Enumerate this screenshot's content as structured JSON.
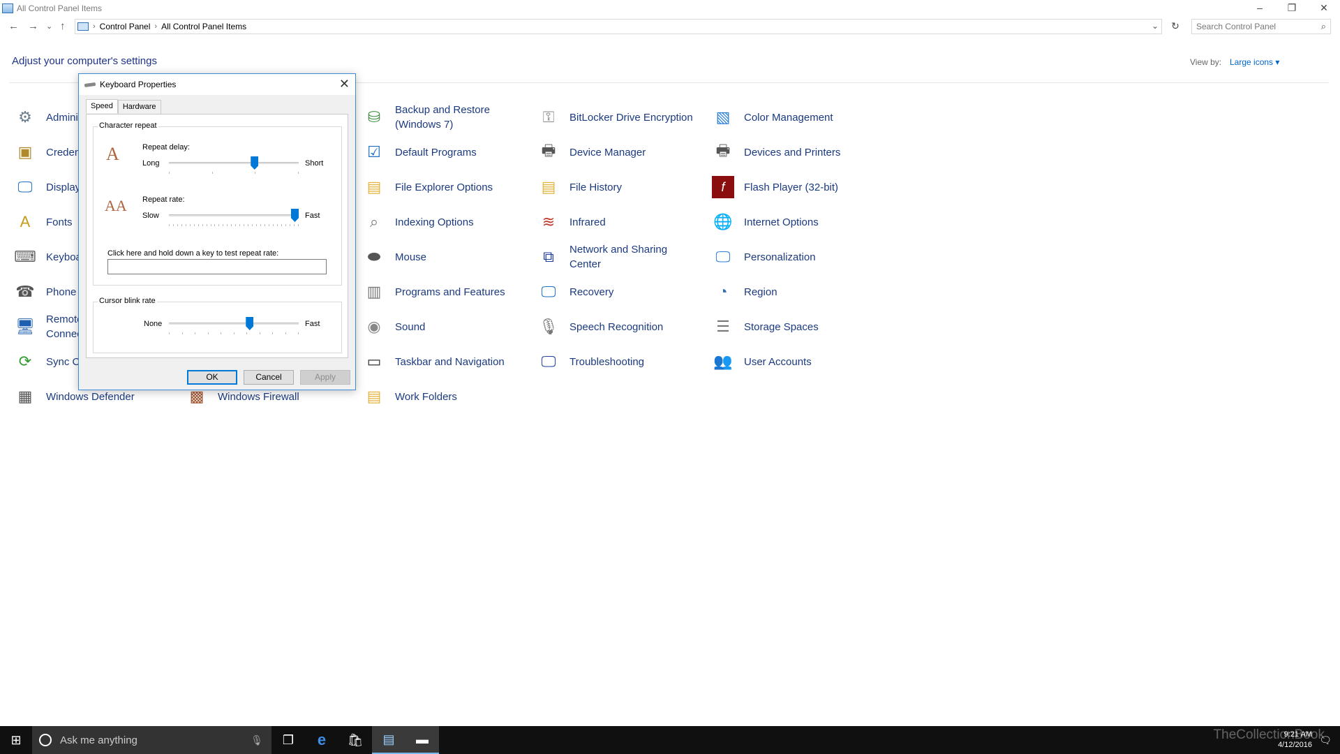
{
  "window": {
    "title": "All Control Panel Items",
    "min": "–",
    "max": "❐",
    "close": "✕"
  },
  "nav": {
    "back": "←",
    "forward": "→",
    "recent": "⌄",
    "up": "↑"
  },
  "address": {
    "crumbs": [
      "Control Panel",
      "All Control Panel Items"
    ],
    "sep": "›",
    "dropdown": "⌄",
    "refresh": "↻"
  },
  "search": {
    "placeholder": "Search Control Panel",
    "icon": "⌕"
  },
  "header": {
    "title": "Adjust your computer's settings",
    "view_by_label": "View by:",
    "view_by_value": "Large icons ▾"
  },
  "items": [
    {
      "label": "Admini",
      "icon": "admin-tools-icon"
    },
    {
      "label": "Creden",
      "icon": "credential-manager-icon"
    },
    {
      "label": "Display",
      "icon": "display-icon"
    },
    {
      "label": "Fonts",
      "icon": "fonts-icon"
    },
    {
      "label": "Keyboa",
      "icon": "keyboard-icon"
    },
    {
      "label": "Phone",
      "icon": "phone-modem-icon"
    },
    {
      "label": "Remote Connec",
      "icon": "remoteapp-icon"
    },
    {
      "label": "Sync C",
      "icon": "sync-center-icon"
    },
    {
      "label": "Windows Defender",
      "icon": "windows-defender-icon"
    },
    {
      "label": "Windows Firewall",
      "icon": "windows-firewall-icon"
    },
    {
      "label": "Backup and Restore (Windows 7)",
      "icon": "backup-icon"
    },
    {
      "label": "Default Programs",
      "icon": "default-programs-icon"
    },
    {
      "label": "File Explorer Options",
      "icon": "folder-options-icon"
    },
    {
      "label": "Indexing Options",
      "icon": "indexing-icon"
    },
    {
      "label": "Mouse",
      "icon": "mouse-icon"
    },
    {
      "label": "Programs and Features",
      "icon": "programs-icon"
    },
    {
      "label": "Sound",
      "icon": "sound-icon"
    },
    {
      "label": "Taskbar and Navigation",
      "icon": "taskbar-icon"
    },
    {
      "label": "Work Folders",
      "icon": "work-folders-icon"
    },
    {
      "label": "BitLocker Drive Encryption",
      "icon": "bitlocker-icon"
    },
    {
      "label": "Device Manager",
      "icon": "device-manager-icon"
    },
    {
      "label": "File History",
      "icon": "file-history-icon"
    },
    {
      "label": "Infrared",
      "icon": "infrared-icon"
    },
    {
      "label": "Network and Sharing Center",
      "icon": "network-icon"
    },
    {
      "label": "Recovery",
      "icon": "recovery-icon"
    },
    {
      "label": "Speech Recognition",
      "icon": "microphone-icon"
    },
    {
      "label": "Troubleshooting",
      "icon": "troubleshooting-icon"
    },
    {
      "label": "Color Management",
      "icon": "color-management-icon"
    },
    {
      "label": "Devices and Printers",
      "icon": "printer-icon"
    },
    {
      "label": "Flash Player (32-bit)",
      "icon": "flash-icon"
    },
    {
      "label": "Internet Options",
      "icon": "globe-icon"
    },
    {
      "label": "Personalization",
      "icon": "personalization-icon"
    },
    {
      "label": "Region",
      "icon": "region-icon"
    },
    {
      "label": "Storage Spaces",
      "icon": "storage-icon"
    },
    {
      "label": "User Accounts",
      "icon": "users-icon"
    }
  ],
  "dialog": {
    "title": "Keyboard Properties",
    "close": "✕",
    "tabs": [
      "Speed",
      "Hardware"
    ],
    "char_repeat": "Character repeat",
    "repeat_delay": "Repeat delay:",
    "long": "Long",
    "short": "Short",
    "repeat_delay_value": 0.67,
    "repeat_rate": "Repeat rate:",
    "slow": "Slow",
    "fast": "Fast",
    "repeat_rate_value": 1.0,
    "test_label": "Click here and hold down a key to test repeat rate:",
    "test_value": "",
    "cursor_blink": "Cursor blink rate",
    "none": "None",
    "fast2": "Fast",
    "cursor_blink_value": 0.63,
    "ok": "OK",
    "cancel": "Cancel",
    "apply": "Apply"
  },
  "taskbar": {
    "start": "⊞",
    "search_placeholder": "Ask me anything",
    "mic": "🎙",
    "apps": [
      {
        "name": "task-view-icon",
        "glyph": "❐"
      },
      {
        "name": "edge-icon",
        "glyph": "e"
      },
      {
        "name": "store-icon",
        "glyph": "🛍"
      },
      {
        "name": "control-panel-icon",
        "glyph": "▤"
      },
      {
        "name": "keyboard-icon",
        "glyph": "▬"
      }
    ],
    "time": "9:21 AM",
    "date": "4/12/2016",
    "notification": "🗨"
  },
  "watermark": "TheCollectionBook"
}
